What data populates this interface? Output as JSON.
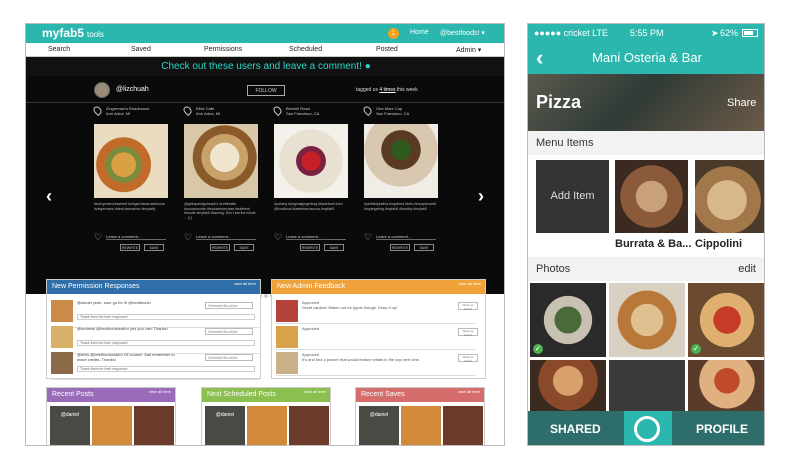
{
  "left": {
    "logo": "myfab5",
    "logo_suffix": "tools",
    "notif_count": "1",
    "home_label": "Home",
    "user_label": "@bestfoods! ▾",
    "nav": [
      "Search",
      "Saved",
      "Permissions",
      "Scheduled",
      "Posted",
      "Admin ▾"
    ],
    "banner": "Check out these users and leave a comment! ●",
    "showcase": {
      "username": "@lizchuah",
      "follow_label": "FOLLOW",
      "tagged_prefix": "tagged us",
      "tagged_count": "4 times",
      "tagged_suffix": "this week",
      "posts": [
        {
          "place": "Zingerman's Roadhouse",
          "city": "Ann Arbor, MI",
          "caption": "#everyonelovesstreet #zingermansroadhouse #zingermans #deal #annarbor #mydaily",
          "comment": "Leave a comment...",
          "b1": "REWRITE",
          "b2": "SAVE"
        },
        {
          "place": "Elixir Café",
          "city": "Ann Arbor, MI",
          "caption": "@getlopandgoheadr's #coffeetalk #sorosmoodie #teahavesrecipes #eatfresh #foodie #myfab5 Warning: Don't eat the whole ... [+]",
          "comment": "Leave a comment...",
          "b1": "REWRITE",
          "b2": "SAVE"
        },
        {
          "place": "Beechil Road",
          "city": "San Francisco, CA",
          "caption": "#yummy #originalgingerfrog #tastefood from @foodlocal #tastefranciscoca #myfab5",
          "comment": "Leave a comment...",
          "b1": "REWRITE",
          "b2": "SAVE"
        },
        {
          "place": "One More Cup",
          "city": "San Francisco, CA",
          "caption": "#yedhikipindiva #mydinea #tofu #ecosysmodel #myangeling #myfab5 #healthy #myfab5",
          "comment": "Leave a comment...",
          "b1": "REWRITE",
          "b2": "SAVE"
        }
      ]
    },
    "perm": {
      "title": "New Permission Responses",
      "view_all": "view all here",
      "rows": [
        {
          "text": "@daniel yeah, sure go for it! @bestfoods!",
          "select": "Website/Booklist",
          "reply": "Thank them for their response!"
        },
        {
          "text": "@melanie @bestfoodsrealtor yes you can! Thanks!",
          "select": "Website/Booklist",
          "reply": "Thank them for their response!"
        },
        {
          "text": "@elvis @bestfoodsrealtor Of course! Just remember to leave credits. Thanks!",
          "select": "Website/Booklist",
          "reply": "Thank them for their response!"
        }
      ]
    },
    "admin": {
      "title": "New Admin Feedback",
      "view_all": "view all here",
      "rows": [
        {
          "status": "Approved",
          "text": "Great caption! Watch out for typos though. Keep it up!",
          "btn": "Mark as Read"
        },
        {
          "status": "Approved",
          "text": "",
          "btn": "Mark as Read"
        },
        {
          "status": "Approved",
          "text": "It's and find a picture that would feature whats in the cup next time.",
          "btn": "Mark as Read"
        }
      ]
    },
    "recent_posts": {
      "title": "Recent Posts",
      "view_all": "view all here",
      "handle": "@daniel"
    },
    "scheduled": {
      "title": "Next Scheduled Posts",
      "view_all": "view all here",
      "handle": "@daniel"
    },
    "saves": {
      "title": "Recent Saves",
      "view_all": "view all here",
      "handle": "@daniel"
    }
  },
  "phone": {
    "carrier": "●●●●● cricket  LTE",
    "time": "5:55 PM",
    "battery": "62%",
    "venue": "Mani Osteria & Bar",
    "hero_title": "Pizza",
    "share_label": "Share",
    "menu_items_label": "Menu Items",
    "add_item_label": "Add Item",
    "menu_items": [
      "Burrata & Ba...",
      "Cippolini"
    ],
    "photos_label": "Photos",
    "edit_label": "edit",
    "tab_shared": "SHARED",
    "tab_profile": "PROFILE"
  },
  "colors": {
    "teal": "#2bb7ad",
    "perm_blue": "#2f6ea8",
    "admin_orange": "#f0a23a",
    "recent_purple": "#9a6bb8",
    "scheduled_green": "#8bbf4e",
    "saves_red": "#d66d6d"
  }
}
